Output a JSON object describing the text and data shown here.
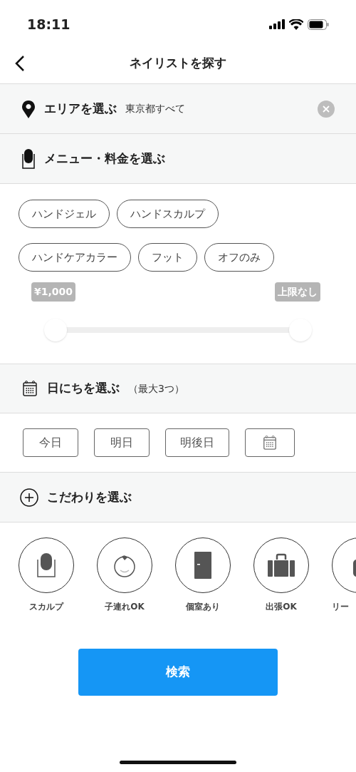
{
  "status_bar": {
    "time": "18:11"
  },
  "header": {
    "title": "ネイリストを探す"
  },
  "area": {
    "label": "エリアを選ぶ",
    "value": "東京都すべて"
  },
  "menu": {
    "label": "メニュー・料金を選ぶ",
    "chips": [
      {
        "label": "ハンドジェル",
        "selected": false
      },
      {
        "label": "ハンドスカルプ",
        "selected": false
      },
      {
        "label": "ハンドケアカラー",
        "selected": false
      },
      {
        "label": "フット",
        "selected": false
      },
      {
        "label": "オフのみ",
        "selected": false
      }
    ],
    "price_slider": {
      "min_handle": {
        "label": "¥1,000",
        "level": 0
      },
      "max_handle": {
        "label": "上限なし",
        "level": 1
      }
    }
  },
  "dates": {
    "label": "日にちを選ぶ",
    "note": "（最大3つ）",
    "options": [
      {
        "kind": "text",
        "label": "今日",
        "selected": false
      },
      {
        "kind": "text",
        "label": "明日",
        "selected": false
      },
      {
        "kind": "text",
        "label": "明後日",
        "selected": false
      },
      {
        "kind": "calendar",
        "selected": false
      }
    ]
  },
  "preferences": {
    "label": "こだわりを選ぶ",
    "items": [
      {
        "kind": "nail",
        "label": "スカルプ"
      },
      {
        "kind": "baby",
        "label": "子連れOK"
      },
      {
        "kind": "door",
        "label": "個室あり"
      },
      {
        "kind": "bag",
        "label": "出張OK"
      },
      {
        "kind": "purse",
        "label": "リー"
      }
    ]
  },
  "search_button": {
    "label": "検索"
  }
}
